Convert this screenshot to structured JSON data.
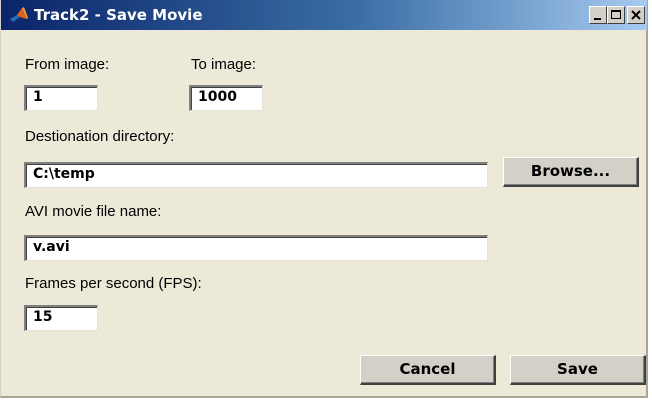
{
  "window": {
    "title": "Track2 - Save Movie"
  },
  "form": {
    "from_image": {
      "label": "From image:",
      "value": "1"
    },
    "to_image": {
      "label": "To image:",
      "value": "1000"
    },
    "destination_dir": {
      "label": "Destionation directory:",
      "value": "C:\\temp"
    },
    "avi_name": {
      "label": "AVI movie file name:",
      "value": "v.avi"
    },
    "fps": {
      "label": "Frames per second (FPS):",
      "value": "15"
    }
  },
  "buttons": {
    "browse": "Browse...",
    "cancel": "Cancel",
    "save": "Save"
  },
  "icons": {
    "app": "matlab-icon",
    "minimize": "minimize-icon",
    "maximize": "maximize-icon",
    "close": "close-icon"
  },
  "colors": {
    "titlebar_start": "#0a246a",
    "titlebar_end": "#a6caf0",
    "dialog_bg": "#ece9d8",
    "button_face": "#d4d0c8"
  }
}
